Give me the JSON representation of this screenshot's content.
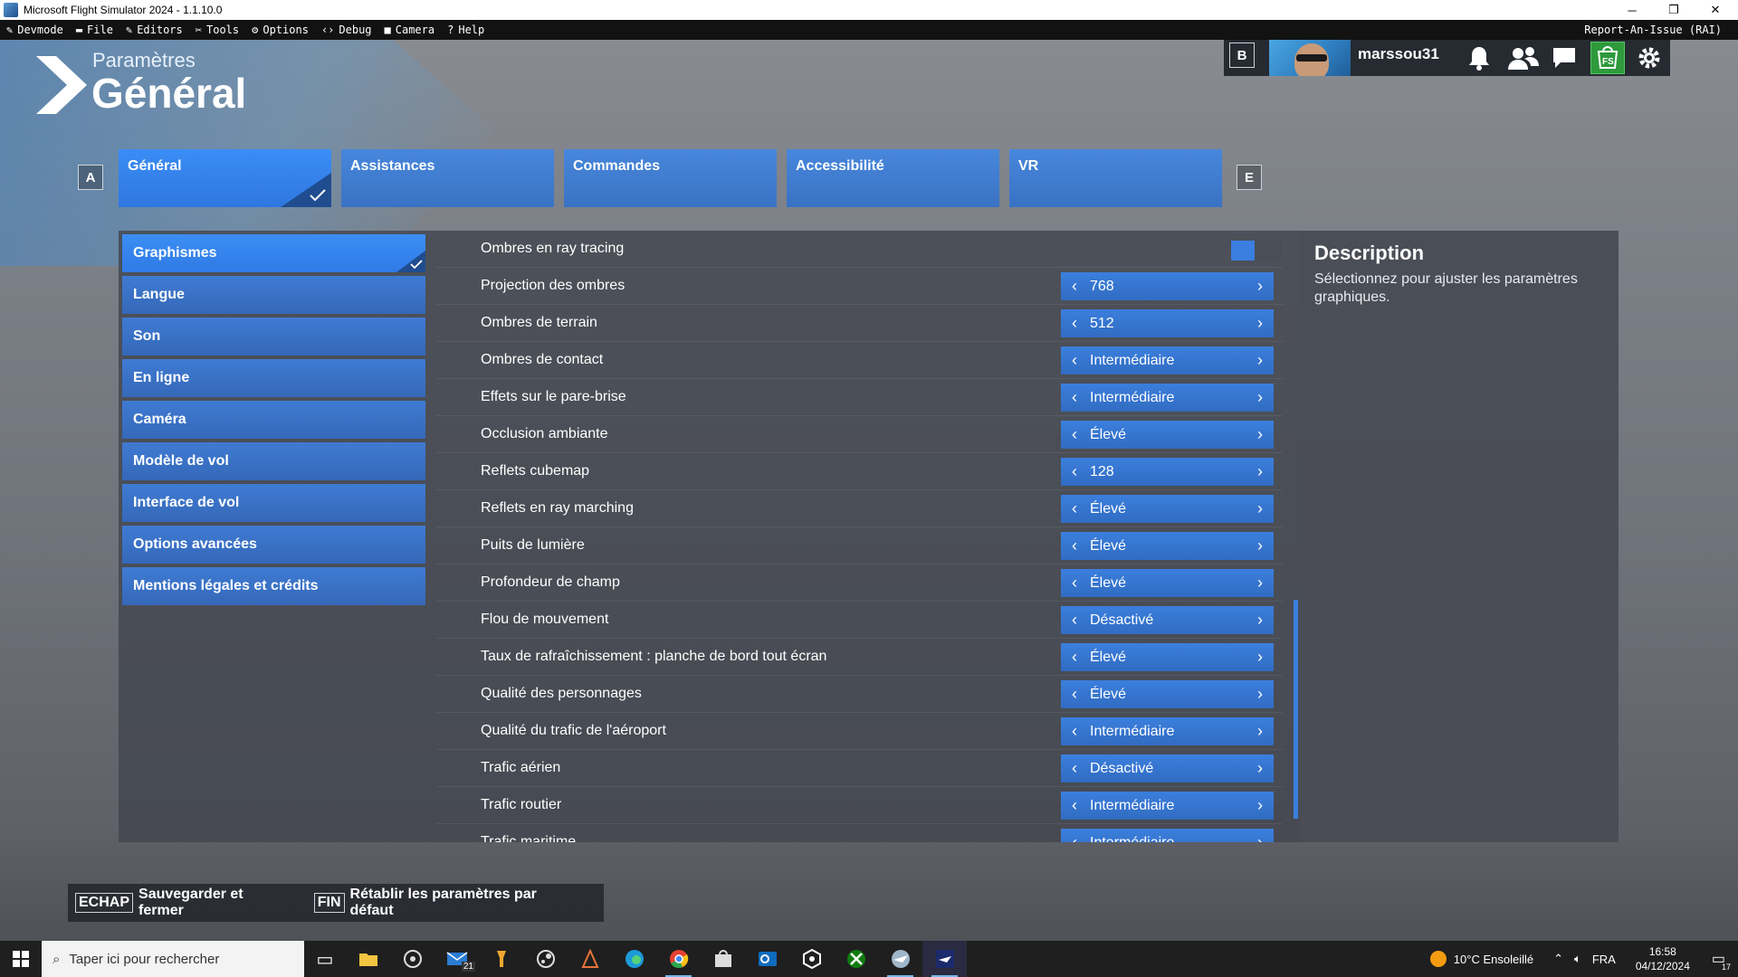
{
  "window": {
    "title": "Microsoft Flight Simulator 2024 - 1.1.10.0",
    "minimize": "─",
    "maximize": "❐",
    "close": "✕"
  },
  "devmenu": {
    "items": [
      {
        "icon": "✎",
        "label": "Devmode"
      },
      {
        "icon": "▬",
        "label": "File"
      },
      {
        "icon": "✎",
        "label": "Editors"
      },
      {
        "icon": "✂",
        "label": "Tools"
      },
      {
        "icon": "⚙",
        "label": "Options"
      },
      {
        "icon": "‹›",
        "label": "Debug"
      },
      {
        "icon": "■",
        "label": "Camera"
      },
      {
        "icon": "?",
        "label": "Help"
      }
    ],
    "rai": "Report-An-Issue (RAI)"
  },
  "header": {
    "subtitle": "Paramètres",
    "title": "Général",
    "b_key": "B",
    "username": "marssou31"
  },
  "tabs": {
    "left_key": "A",
    "right_key": "E",
    "items": [
      {
        "label": "Général",
        "active": true
      },
      {
        "label": "Assistances"
      },
      {
        "label": "Commandes"
      },
      {
        "label": "Accessibilité"
      },
      {
        "label": "VR"
      }
    ]
  },
  "sidebar": {
    "items": [
      {
        "label": "Graphismes",
        "active": true
      },
      {
        "label": "Langue"
      },
      {
        "label": "Son"
      },
      {
        "label": "En ligne"
      },
      {
        "label": "Caméra"
      },
      {
        "label": "Modèle de vol"
      },
      {
        "label": "Interface de vol"
      },
      {
        "label": "Options avancées"
      },
      {
        "label": "Mentions légales et crédits"
      }
    ]
  },
  "settings": [
    {
      "label": "Ombres en ray tracing",
      "type": "toggle",
      "value": "on"
    },
    {
      "label": "Projection des ombres",
      "value": "768"
    },
    {
      "label": "Ombres de terrain",
      "value": "512"
    },
    {
      "label": "Ombres de contact",
      "value": "Intermédiaire"
    },
    {
      "label": "Effets sur le pare-brise",
      "value": "Intermédiaire"
    },
    {
      "label": "Occlusion ambiante",
      "value": "Élevé"
    },
    {
      "label": "Reflets cubemap",
      "value": "128"
    },
    {
      "label": "Reflets en ray marching",
      "value": "Élevé"
    },
    {
      "label": "Puits de lumière",
      "value": "Élevé"
    },
    {
      "label": "Profondeur de champ",
      "value": "Élevé"
    },
    {
      "label": "Flou de mouvement",
      "value": "Désactivé"
    },
    {
      "label": "Taux de rafraîchissement : planche de bord tout écran",
      "value": "Élevé"
    },
    {
      "label": "Qualité des personnages",
      "value": "Élevé"
    },
    {
      "label": "Qualité du trafic de l'aéroport",
      "value": "Intermédiaire"
    },
    {
      "label": "Trafic aérien",
      "value": "Désactivé"
    },
    {
      "label": "Trafic routier",
      "value": "Intermédiaire"
    },
    {
      "label": "Trafic maritime",
      "value": "Intermédiaire"
    }
  ],
  "arrows": {
    "left": "‹",
    "right": "›"
  },
  "description": {
    "title": "Description",
    "text": "Sélectionnez pour ajuster les paramètres graphiques."
  },
  "footer": {
    "save_key": "ECHAP",
    "save_label": "Sauvegarder et fermer",
    "reset_key": "FIN",
    "reset_label": "Rétablir les paramètres par défaut"
  },
  "taskbar": {
    "search_placeholder": "Taper ici pour rechercher",
    "mail_badge": "21",
    "weather": "10°C  Ensoleillé",
    "language": "FRA",
    "time": "16:58",
    "date": "04/12/2024",
    "notifications": "17"
  },
  "colors": {
    "accent": "#3a7ee0",
    "panel": "#42464e",
    "taskbar": "#1f1f1f"
  }
}
